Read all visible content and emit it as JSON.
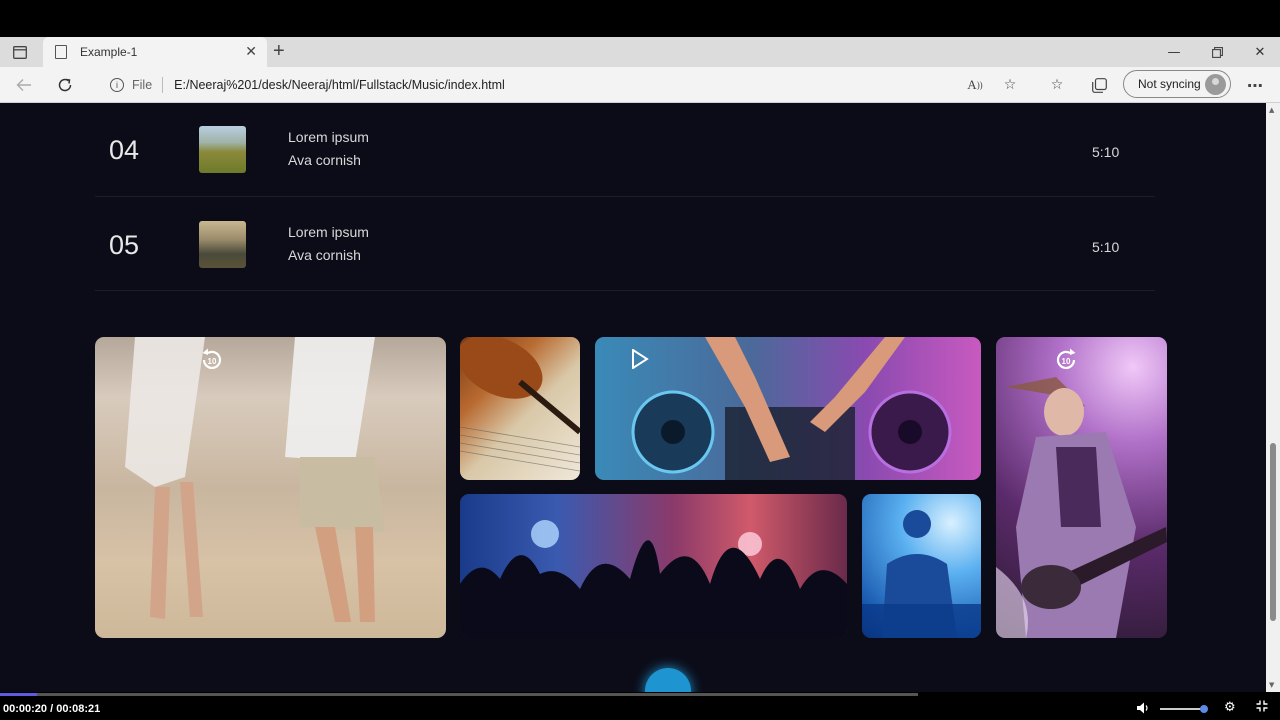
{
  "browser": {
    "tab_title": "Example-1",
    "new_tab_symbol": "+",
    "file_label": "File",
    "url": "E:/Neeraj%201/desk/Neeraj/html/Fullstack/Music/index.html",
    "sync_label": "Not syncing"
  },
  "songs": [
    {
      "number": "04",
      "title": "Lorem ipsum",
      "artist": "Ava cornish",
      "duration": "5:10"
    },
    {
      "number": "05",
      "title": "Lorem ipsum",
      "artist": "Ava cornish",
      "duration": "5:10"
    }
  ],
  "gallery": {
    "tiles": [
      {
        "name": "couple-beach",
        "icon": "replay-10-icon"
      },
      {
        "name": "violin-sheet",
        "icon": ""
      },
      {
        "name": "dj-mixer",
        "icon": "play-icon"
      },
      {
        "name": "guitarist",
        "icon": "forward-10-icon"
      },
      {
        "name": "concert-crowd",
        "icon": ""
      },
      {
        "name": "dj-silhouette",
        "icon": ""
      }
    ],
    "skip_label": "10"
  },
  "player": {
    "current_time": "00:00:20",
    "total_time": "00:08:21",
    "progress": 0.04,
    "volume": 0.95
  }
}
